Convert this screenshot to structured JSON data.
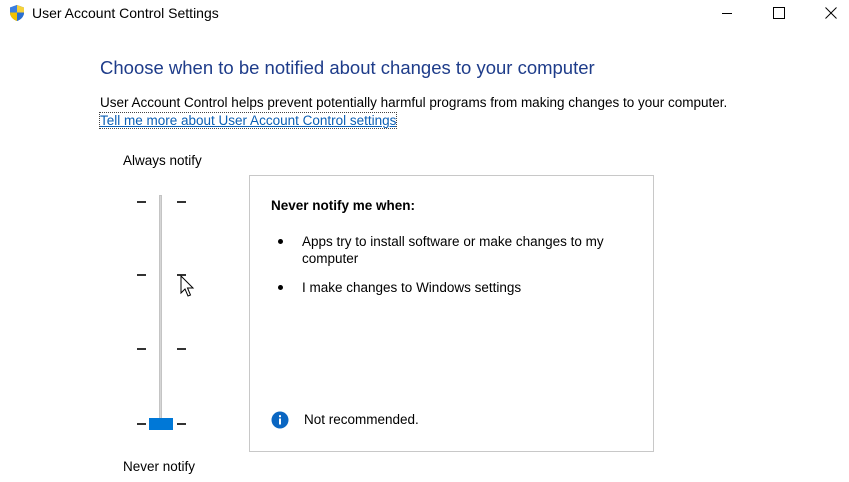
{
  "window": {
    "title": "User Account Control Settings",
    "icon": "uac-shield-icon",
    "controls": [
      "minimize-icon",
      "maximize-icon",
      "close-icon"
    ]
  },
  "main": {
    "heading": "Choose when to be notified about changes to your computer",
    "description": "User Account Control helps prevent potentially harmful programs from making changes to your computer.",
    "link_text": "Tell me more about User Account Control settings"
  },
  "slider": {
    "top_label": "Always notify",
    "bottom_label": "Never notify",
    "levels": 4,
    "selected_level": 1,
    "selected_description": "lowest"
  },
  "panel": {
    "title": "Never notify me when:",
    "bullets": [
      "Apps try to install software or make changes to my computer",
      "I make changes to Windows settings"
    ],
    "info_text": "Not recommended."
  },
  "colors": {
    "heading": "#1e3c8a",
    "link": "#0b5fb5",
    "accent": "#0078d7",
    "info": "#0a66c2"
  }
}
